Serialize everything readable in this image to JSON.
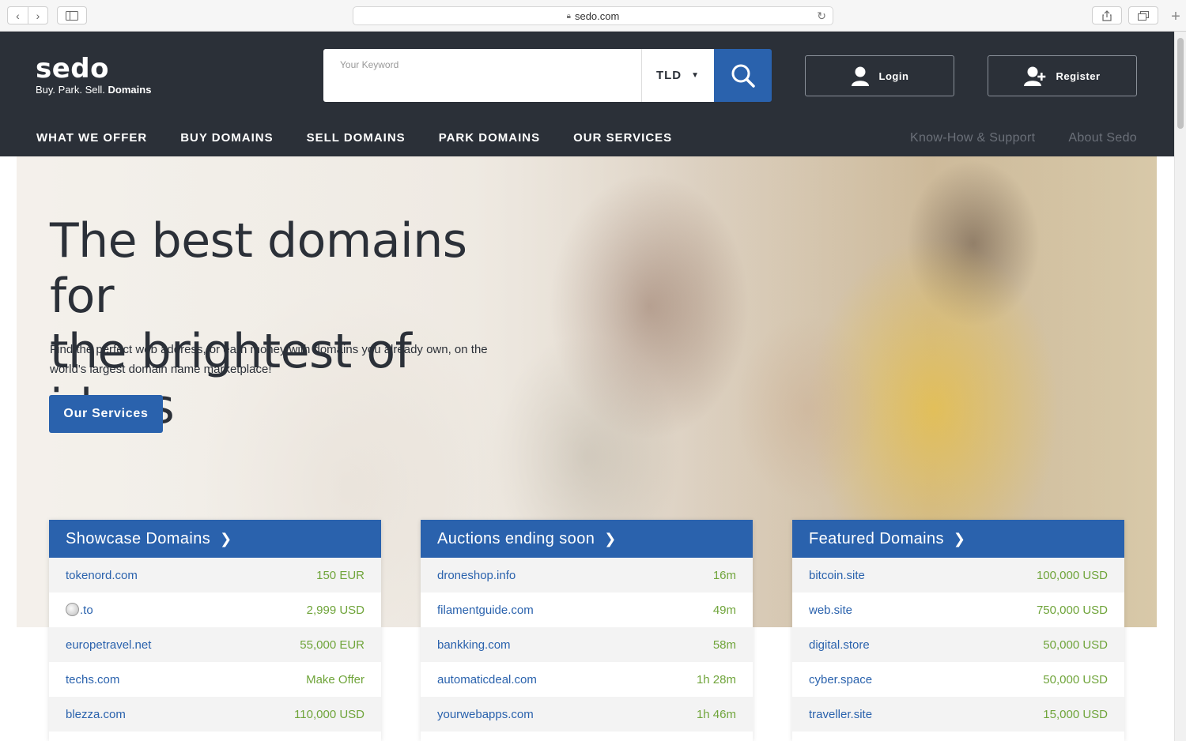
{
  "browser": {
    "url": "sedo.com"
  },
  "brand": {
    "name": "sedo",
    "tagline_prefix": "Buy. Park. Sell.",
    "tagline_bold": "Domains"
  },
  "search": {
    "placeholder": "Your Keyword",
    "tld_label": "TLD"
  },
  "auth": {
    "login": "Login",
    "register": "Register"
  },
  "nav": {
    "main": [
      "WHAT WE OFFER",
      "BUY DOMAINS",
      "SELL DOMAINS",
      "PARK DOMAINS",
      "OUR SERVICES"
    ],
    "secondary": [
      "Know-How & Support",
      "About Sedo"
    ]
  },
  "hero": {
    "headline_line1": "The best domains for",
    "headline_line2": "the brightest of ideas",
    "description": "Find the perfect web address, or earn money with domains you already own, on the world's largest domain name marketplace!",
    "cta": "Our Services"
  },
  "panels": [
    {
      "title": "Showcase Domains",
      "rows": [
        {
          "domain": "tokenord.com",
          "value": "150 EUR"
        },
        {
          "domain": ".to",
          "value": "2,999 USD",
          "emoji": "baseball-icon"
        },
        {
          "domain": "europetravel.net",
          "value": "55,000 EUR"
        },
        {
          "domain": "techs.com",
          "value": "Make Offer"
        },
        {
          "domain": "blezza.com",
          "value": "110,000 USD"
        }
      ]
    },
    {
      "title": "Auctions ending soon",
      "rows": [
        {
          "domain": "droneshop.info",
          "value": "16m"
        },
        {
          "domain": "filamentguide.com",
          "value": "49m"
        },
        {
          "domain": "bankking.com",
          "value": "58m"
        },
        {
          "domain": "automaticdeal.com",
          "value": "1h 28m"
        },
        {
          "domain": "yourwebapps.com",
          "value": "1h 46m"
        }
      ]
    },
    {
      "title": "Featured Domains",
      "rows": [
        {
          "domain": "bitcoin.site",
          "value": "100,000 USD"
        },
        {
          "domain": "web.site",
          "value": "750,000 USD"
        },
        {
          "domain": "digital.store",
          "value": "50,000 USD"
        },
        {
          "domain": "cyber.space",
          "value": "50,000 USD"
        },
        {
          "domain": "traveller.site",
          "value": "15,000 USD"
        }
      ]
    }
  ],
  "colors": {
    "header_bg": "#2b3038",
    "brand_blue": "#2a62ad",
    "price_green": "#6fa43a"
  }
}
